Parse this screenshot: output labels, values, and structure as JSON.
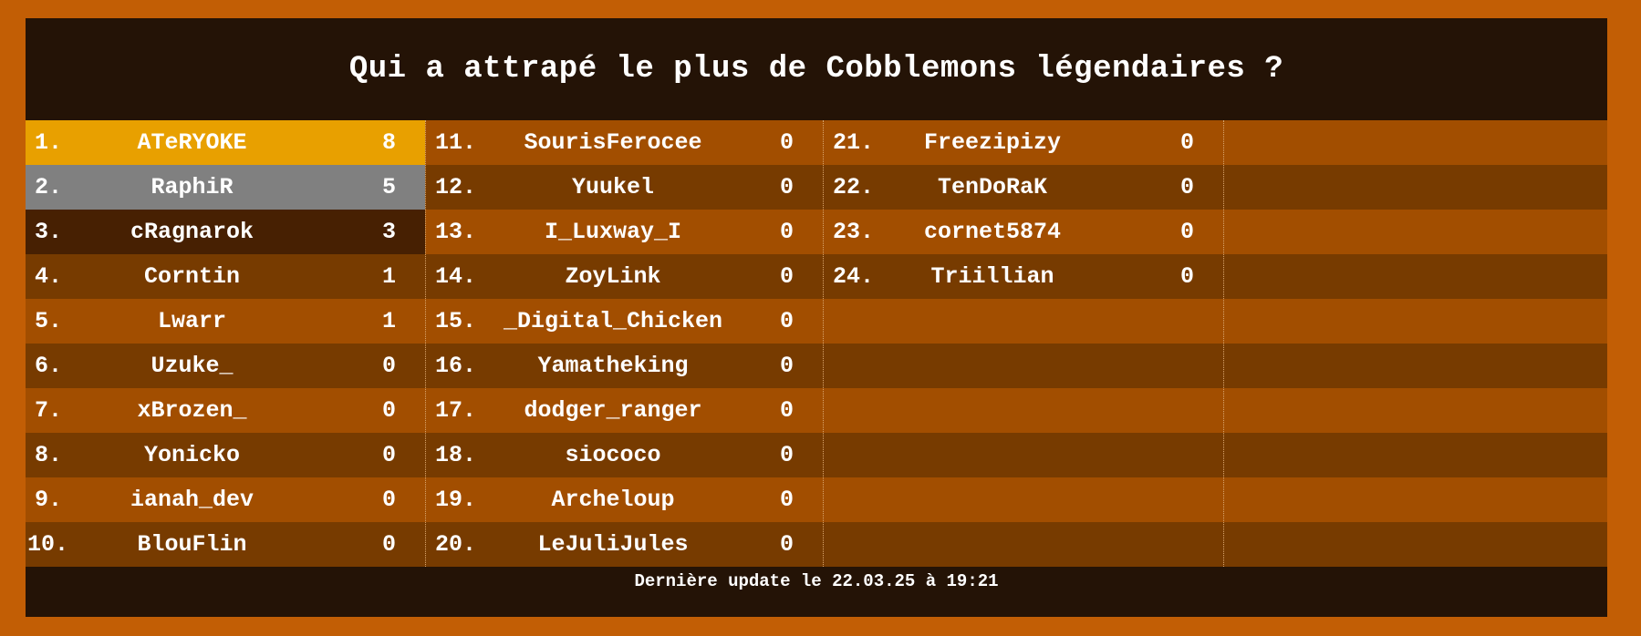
{
  "title": "Qui a attrapé le plus de Cobblemons légendaires ?",
  "footer": "Dernière update le 22.03.25 à 19:21",
  "columns": [
    [
      {
        "rank": "1.",
        "name": "ATeRYOKE",
        "score": "8"
      },
      {
        "rank": "2.",
        "name": "RaphiR",
        "score": "5"
      },
      {
        "rank": "3.",
        "name": "cRagnarok",
        "score": "3"
      },
      {
        "rank": "4.",
        "name": "Corntin",
        "score": "1"
      },
      {
        "rank": "5.",
        "name": "Lwarr",
        "score": "1"
      },
      {
        "rank": "6.",
        "name": "Uzuke_",
        "score": "0"
      },
      {
        "rank": "7.",
        "name": "xBrozen_",
        "score": "0"
      },
      {
        "rank": "8.",
        "name": "Yonicko",
        "score": "0"
      },
      {
        "rank": "9.",
        "name": "ianah_dev",
        "score": "0"
      },
      {
        "rank": "10.",
        "name": "BlouFlin",
        "score": "0"
      }
    ],
    [
      {
        "rank": "11.",
        "name": "SourisFerocee",
        "score": "0"
      },
      {
        "rank": "12.",
        "name": "Yuukel",
        "score": "0"
      },
      {
        "rank": "13.",
        "name": "I_Luxway_I",
        "score": "0"
      },
      {
        "rank": "14.",
        "name": "ZoyLink",
        "score": "0"
      },
      {
        "rank": "15.",
        "name": "_Digital_Chicken",
        "score": "0"
      },
      {
        "rank": "16.",
        "name": "Yamatheking",
        "score": "0"
      },
      {
        "rank": "17.",
        "name": "dodger_ranger",
        "score": "0"
      },
      {
        "rank": "18.",
        "name": "siococo",
        "score": "0"
      },
      {
        "rank": "19.",
        "name": "Archeloup",
        "score": "0"
      },
      {
        "rank": "20.",
        "name": "LeJuliJules",
        "score": "0"
      }
    ],
    [
      {
        "rank": "21.",
        "name": "Freezipizy",
        "score": "0"
      },
      {
        "rank": "22.",
        "name": "TenDoRaK",
        "score": "0"
      },
      {
        "rank": "23.",
        "name": "cornet5874",
        "score": "0"
      },
      {
        "rank": "24.",
        "name": "Triillian",
        "score": "0"
      }
    ]
  ],
  "colors": {
    "frame": "#c25e05",
    "panel": "#241306",
    "row_light": "#a24e00",
    "row_dark": "#773b00",
    "first": "#e8a000",
    "second": "#808080",
    "third": "#472002"
  }
}
